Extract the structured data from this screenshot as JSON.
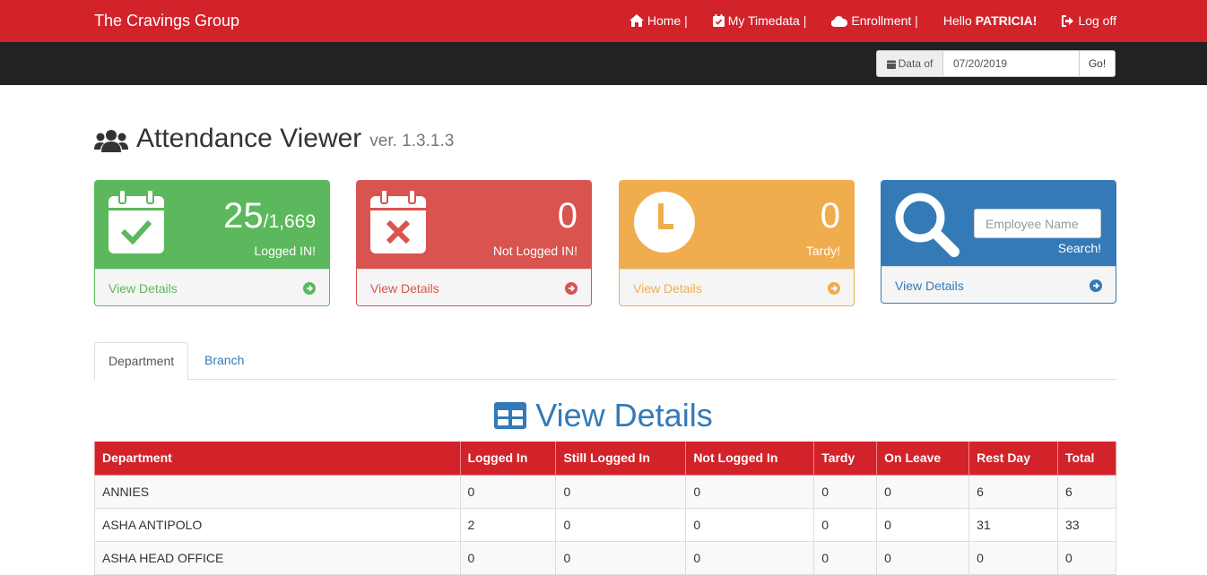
{
  "navbar": {
    "brand": "The Cravings Group",
    "home": "Home |",
    "timedata": "My Timedata |",
    "enrollment": "Enrollment |",
    "hello_prefix": "Hello",
    "user": "PATRICIA!",
    "logoff": "Log off"
  },
  "datebar": {
    "addon_label": "Data of",
    "date_value": "07/20/2019",
    "go_label": "Go!"
  },
  "page": {
    "title": "Attendance Viewer",
    "version": "ver. 1.3.1.3"
  },
  "panels": {
    "logged_in": {
      "count": "25",
      "total": "/1,669",
      "caption": "Logged IN!",
      "link": "View Details",
      "color": "#5cb85c"
    },
    "not_logged_in": {
      "count": "0",
      "caption": "Not Logged IN!",
      "link": "View Details",
      "color": "#d9534f"
    },
    "tardy": {
      "count": "0",
      "caption": "Tardy!",
      "link": "View Details",
      "color": "#f0ad4e"
    },
    "search": {
      "placeholder": "Employee Name",
      "caption": "Search!",
      "link": "View Details",
      "color": "#337ab7"
    }
  },
  "tabs": {
    "department": "Department",
    "branch": "Branch"
  },
  "section_title": "View Details",
  "table": {
    "headers": [
      "Department",
      "Logged In",
      "Still Logged In",
      "Not Logged In",
      "Tardy",
      "On Leave",
      "Rest Day",
      "Total"
    ],
    "rows": [
      [
        "ANNIES",
        "0",
        "0",
        "0",
        "0",
        "0",
        "6",
        "6"
      ],
      [
        "ASHA ANTIPOLO",
        "2",
        "0",
        "0",
        "0",
        "0",
        "31",
        "33"
      ],
      [
        "ASHA HEAD OFFICE",
        "0",
        "0",
        "0",
        "0",
        "0",
        "0",
        "0"
      ]
    ]
  },
  "colors": {
    "brand_red": "#d2232b",
    "dark_bar": "#222222",
    "link_blue": "#337ab7"
  }
}
